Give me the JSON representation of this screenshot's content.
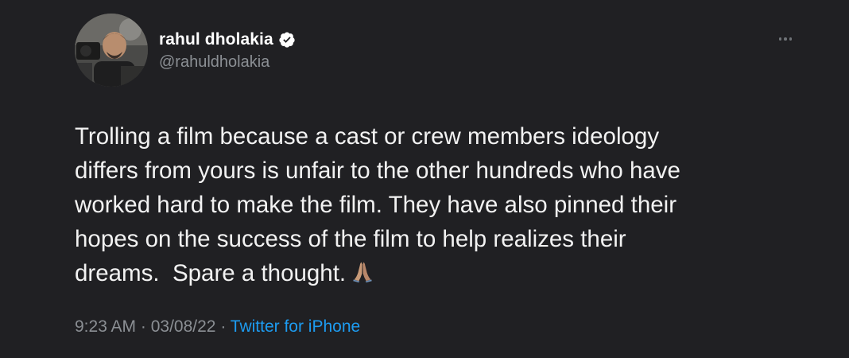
{
  "tweet": {
    "display_name": "rahul dholakia",
    "handle": "@rahuldholakia",
    "verified_icon": "verified-badge-icon",
    "more_icon": "more-options-icon",
    "body_lines": [
      "Trolling a film because a cast or crew members ideology",
      "differs from yours is unfair to the other hundreds who have",
      "worked hard to make the film. They have also pinned their",
      "hopes on the success of the film to help realizes their",
      "dreams.  Spare a thought."
    ],
    "emoji": "folded-hands-emoji",
    "time": "9:23 AM",
    "separator1": " · ",
    "date": "03/08/22",
    "separator2": " · ",
    "source": "Twitter for iPhone"
  },
  "colors": {
    "background": "#202023",
    "text": "#f2f2f2",
    "muted": "#8b8f94",
    "link": "#1d9bf0",
    "verified": "#ffffff"
  }
}
